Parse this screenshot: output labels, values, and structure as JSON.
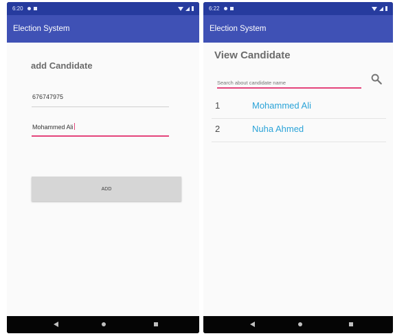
{
  "left_screen": {
    "status_time": "6:20",
    "app_title": "Election System",
    "form_title": "add Candidate",
    "id_value": "676747975",
    "name_value": "Mohammed Ali",
    "add_button_label": "ADD"
  },
  "right_screen": {
    "status_time": "6:22",
    "app_title": "Election System",
    "page_title": "View Candidate",
    "search_placeholder": "Search about candidate name",
    "candidates": [
      {
        "number": "1",
        "name": "Mohammed Ali"
      },
      {
        "number": "2",
        "name": "Nuha Ahmed"
      }
    ]
  },
  "icons": [
    "wifi-icon",
    "signal-icon",
    "battery-icon",
    "search-icon",
    "back-icon",
    "home-icon",
    "recent-apps-icon"
  ],
  "colors": {
    "status_bar": "#263b9e",
    "app_bar": "#3f51b5",
    "accent_underline": "#e4437a",
    "list_name": "#2aa3d8",
    "button": "#d6d6d6"
  }
}
